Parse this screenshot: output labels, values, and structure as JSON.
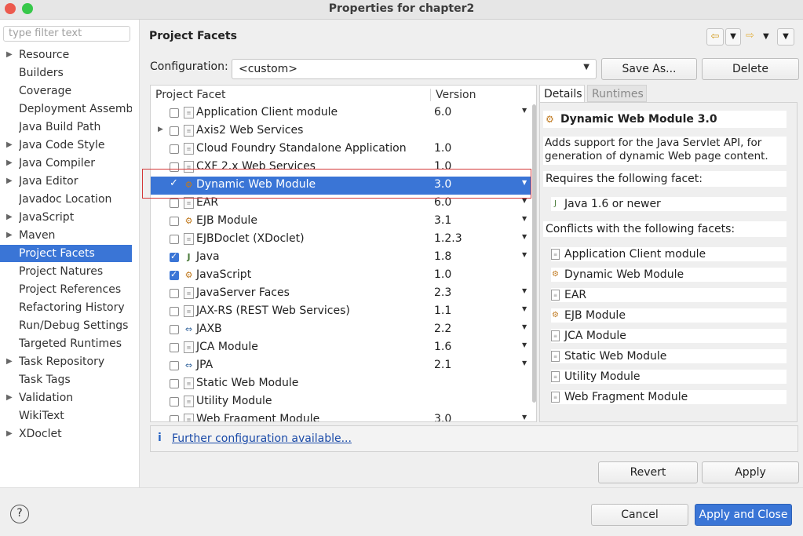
{
  "window": {
    "title": "Properties for chapter2"
  },
  "filter": {
    "placeholder": "type filter text"
  },
  "nav": [
    {
      "label": "Resource",
      "expand": true
    },
    {
      "label": "Builders",
      "expand": false
    },
    {
      "label": "Coverage",
      "expand": false
    },
    {
      "label": "Deployment Assembly",
      "expand": false
    },
    {
      "label": "Java Build Path",
      "expand": false
    },
    {
      "label": "Java Code Style",
      "expand": true
    },
    {
      "label": "Java Compiler",
      "expand": true
    },
    {
      "label": "Java Editor",
      "expand": true
    },
    {
      "label": "Javadoc Location",
      "expand": false
    },
    {
      "label": "JavaScript",
      "expand": true
    },
    {
      "label": "Maven",
      "expand": true
    },
    {
      "label": "Project Facets",
      "expand": false,
      "selected": true
    },
    {
      "label": "Project Natures",
      "expand": false
    },
    {
      "label": "Project References",
      "expand": false
    },
    {
      "label": "Refactoring History",
      "expand": false
    },
    {
      "label": "Run/Debug Settings",
      "expand": false
    },
    {
      "label": "Targeted Runtimes",
      "expand": false
    },
    {
      "label": "Task Repository",
      "expand": true
    },
    {
      "label": "Task Tags",
      "expand": false
    },
    {
      "label": "Validation",
      "expand": true
    },
    {
      "label": "WikiText",
      "expand": false
    },
    {
      "label": "XDoclet",
      "expand": true
    }
  ],
  "page": {
    "title": "Project Facets"
  },
  "config": {
    "label": "Configuration:",
    "value": "<custom>",
    "save_as": "Save As...",
    "delete": "Delete"
  },
  "facets": {
    "col_facet": "Project Facet",
    "col_version": "Version",
    "rows": [
      {
        "name": "Application Client module",
        "version": "6.0",
        "checked": false,
        "icon": "doc",
        "dropdown": true
      },
      {
        "name": "Axis2 Web Services",
        "version": "",
        "checked": false,
        "icon": "doc",
        "expand": true,
        "dropdown": false
      },
      {
        "name": "Cloud Foundry Standalone Application",
        "version": "1.0",
        "checked": false,
        "icon": "doc",
        "dropdown": false
      },
      {
        "name": "CXF 2.x Web Services",
        "version": "1.0",
        "checked": false,
        "icon": "doc",
        "dropdown": false
      },
      {
        "name": "Dynamic Web Module",
        "version": "3.0",
        "checked": true,
        "icon": "gear",
        "selected": true,
        "dropdown": true
      },
      {
        "name": "EAR",
        "version": "6.0",
        "checked": false,
        "icon": "doc",
        "dropdown": true
      },
      {
        "name": "EJB Module",
        "version": "3.1",
        "checked": false,
        "icon": "gear",
        "dropdown": true
      },
      {
        "name": "EJBDoclet (XDoclet)",
        "version": "1.2.3",
        "checked": false,
        "icon": "doc",
        "dropdown": true
      },
      {
        "name": "Java",
        "version": "1.8",
        "checked": true,
        "icon": "jar",
        "dropdown": true
      },
      {
        "name": "JavaScript",
        "version": "1.0",
        "checked": true,
        "icon": "gear",
        "dropdown": false
      },
      {
        "name": "JavaServer Faces",
        "version": "2.3",
        "checked": false,
        "icon": "doc",
        "dropdown": true
      },
      {
        "name": "JAX-RS (REST Web Services)",
        "version": "1.1",
        "checked": false,
        "icon": "doc",
        "dropdown": true
      },
      {
        "name": "JAXB",
        "version": "2.2",
        "checked": false,
        "icon": "pkg",
        "dropdown": true
      },
      {
        "name": "JCA Module",
        "version": "1.6",
        "checked": false,
        "icon": "doc",
        "dropdown": true
      },
      {
        "name": "JPA",
        "version": "2.1",
        "checked": false,
        "icon": "pkg",
        "dropdown": true
      },
      {
        "name": "Static Web Module",
        "version": "",
        "checked": false,
        "icon": "doc",
        "dropdown": false
      },
      {
        "name": "Utility Module",
        "version": "",
        "checked": false,
        "icon": "doc",
        "dropdown": false
      },
      {
        "name": "Web Fragment Module",
        "version": "3.0",
        "checked": false,
        "icon": "doc",
        "dropdown": true
      }
    ]
  },
  "details": {
    "tab_details": "Details",
    "tab_runtimes": "Runtimes",
    "facet_title": "Dynamic Web Module 3.0",
    "description": "Adds support for the Java Servlet API, for generation of dynamic Web page content.",
    "requires_label": "Requires the following facet:",
    "requires": [
      {
        "name": "Java 1.6 or newer",
        "icon": "jar"
      }
    ],
    "conflicts_label": "Conflicts with the following facets:",
    "conflicts": [
      {
        "name": "Application Client module",
        "icon": "doc"
      },
      {
        "name": "Dynamic Web Module",
        "icon": "gear"
      },
      {
        "name": "EAR",
        "icon": "doc"
      },
      {
        "name": "EJB Module",
        "icon": "gear"
      },
      {
        "name": "JCA Module",
        "icon": "doc"
      },
      {
        "name": "Static Web Module",
        "icon": "doc"
      },
      {
        "name": "Utility Module",
        "icon": "doc"
      },
      {
        "name": "Web Fragment Module",
        "icon": "doc"
      }
    ]
  },
  "info": {
    "icon": "i",
    "link": "Further configuration available..."
  },
  "buttons": {
    "revert": "Revert",
    "apply": "Apply",
    "cancel": "Cancel",
    "apply_close": "Apply and Close",
    "help": "?"
  },
  "colors": {
    "selection": "#3a75d6",
    "close_dot": "#ec5a4e",
    "max_dot": "#37c84a",
    "highlight": "#d43838"
  }
}
